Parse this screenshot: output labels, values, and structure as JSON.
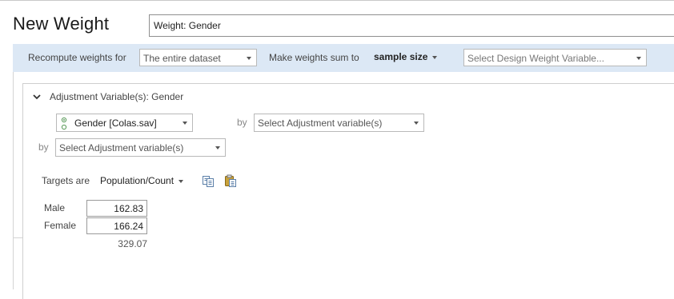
{
  "header": {
    "title": "New Weight",
    "name_value": "Weight: Gender"
  },
  "options": {
    "recompute_label": "Recompute weights for",
    "recompute_value": "The entire dataset",
    "sum_label": "Make weights sum to",
    "sum_value": "sample size",
    "design_weight_placeholder": "Select Design Weight Variable..."
  },
  "adjustment": {
    "title": "Adjustment Variable(s): Gender",
    "variable_value": "Gender [Colas.sav]",
    "by_label": "by",
    "select_placeholder": "Select Adjustment variable(s)"
  },
  "targets": {
    "label": "Targets are",
    "value": "Population/Count",
    "rows": [
      {
        "label": "Male",
        "value": "162.83"
      },
      {
        "label": "Female",
        "value": "166.24"
      }
    ],
    "total": "329.07"
  },
  "icons": {
    "collapse": "chevron-down-icon",
    "variable_type": "categorical-variable-icon",
    "copy": "copy-icon",
    "paste": "paste-icon"
  },
  "colors": {
    "options_bar_bg": "#dce8f5"
  }
}
